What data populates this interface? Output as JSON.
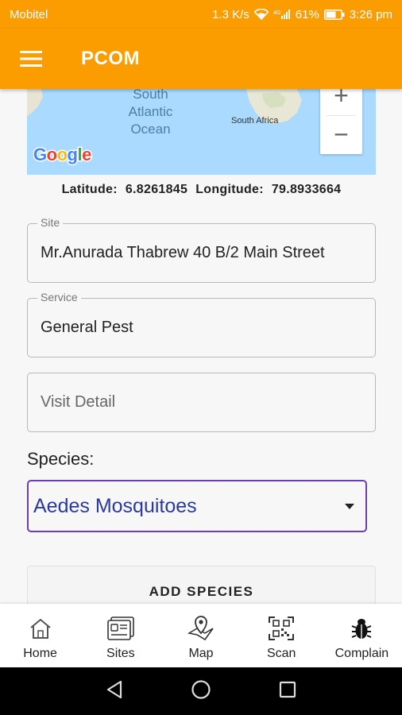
{
  "status_bar": {
    "carrier": "Mobitel",
    "network_speed": "1.3 K/s",
    "signal_label": "4G",
    "battery": "61%",
    "time": "3:26 pm"
  },
  "app_bar": {
    "title": "PCOM",
    "menu_icon": "hamburger-menu-icon"
  },
  "map": {
    "ocean_line1": "South",
    "ocean_line2": "Atlantic",
    "ocean_line3": "Ocean",
    "country": "South Africa",
    "attribution": "Google",
    "zoom_in": "+",
    "zoom_out": "−"
  },
  "location": {
    "latitude_label": "Latitude:",
    "latitude": "6.8261845",
    "longitude_label": "Longitude:",
    "longitude": "79.8933664"
  },
  "form": {
    "site_label": "Site",
    "site_value": "Mr.Anurada Thabrew 40 B/2 Main Street",
    "service_label": "Service",
    "service_value": "General Pest",
    "visit_detail_placeholder": "Visit Detail",
    "species_label": "Species:",
    "species_value": "Aedes Mosquitoes",
    "add_species_label": "ADD SPECIES"
  },
  "bottom_nav": {
    "items": [
      {
        "label": "Home",
        "icon": "home-icon"
      },
      {
        "label": "Sites",
        "icon": "sites-icon"
      },
      {
        "label": "Map",
        "icon": "map-pin-icon"
      },
      {
        "label": "Scan",
        "icon": "qr-scan-icon"
      },
      {
        "label": "Complain",
        "icon": "bug-icon"
      }
    ]
  },
  "colors": {
    "primary": "#fb9c00",
    "accent": "#6a3fb0",
    "dropdown_text": "#2a3aa0"
  }
}
